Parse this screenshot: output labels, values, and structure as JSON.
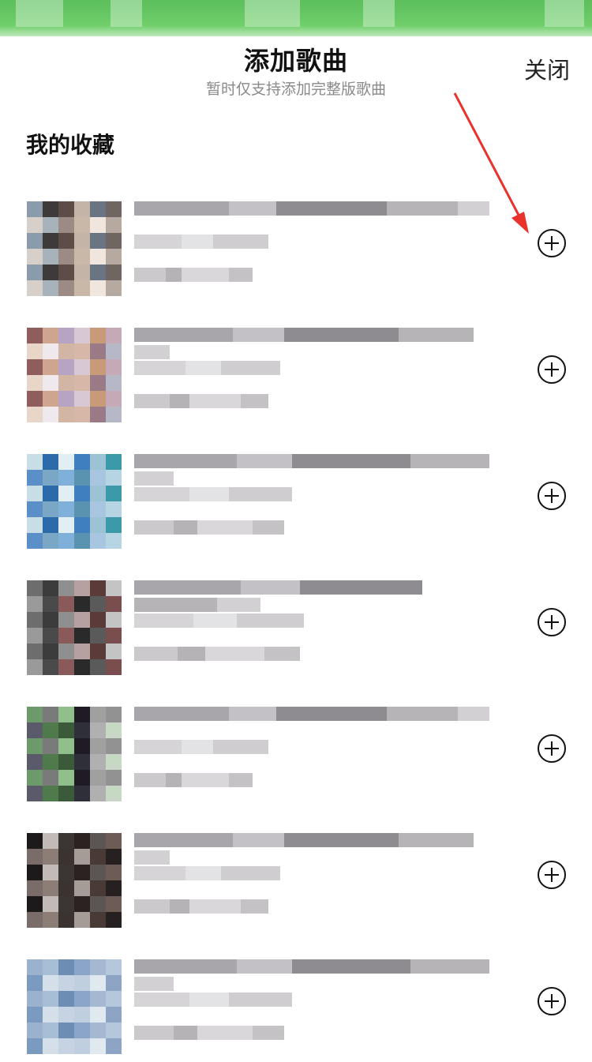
{
  "sheet": {
    "title": "添加歌曲",
    "subtitle": "暂时仅支持添加完整版歌曲",
    "close_label": "关闭"
  },
  "section": {
    "title": "我的收藏"
  },
  "songs": [
    {
      "add_icon": "plus-circle-icon"
    },
    {
      "add_icon": "plus-circle-icon"
    },
    {
      "add_icon": "plus-circle-icon"
    },
    {
      "add_icon": "plus-circle-icon"
    },
    {
      "add_icon": "plus-circle-icon"
    },
    {
      "add_icon": "plus-circle-icon"
    },
    {
      "add_icon": "plus-circle-icon"
    }
  ],
  "annotation": {
    "arrow_color": "#e8322b"
  },
  "colors": {
    "accent_green": "#5cbf5c"
  }
}
